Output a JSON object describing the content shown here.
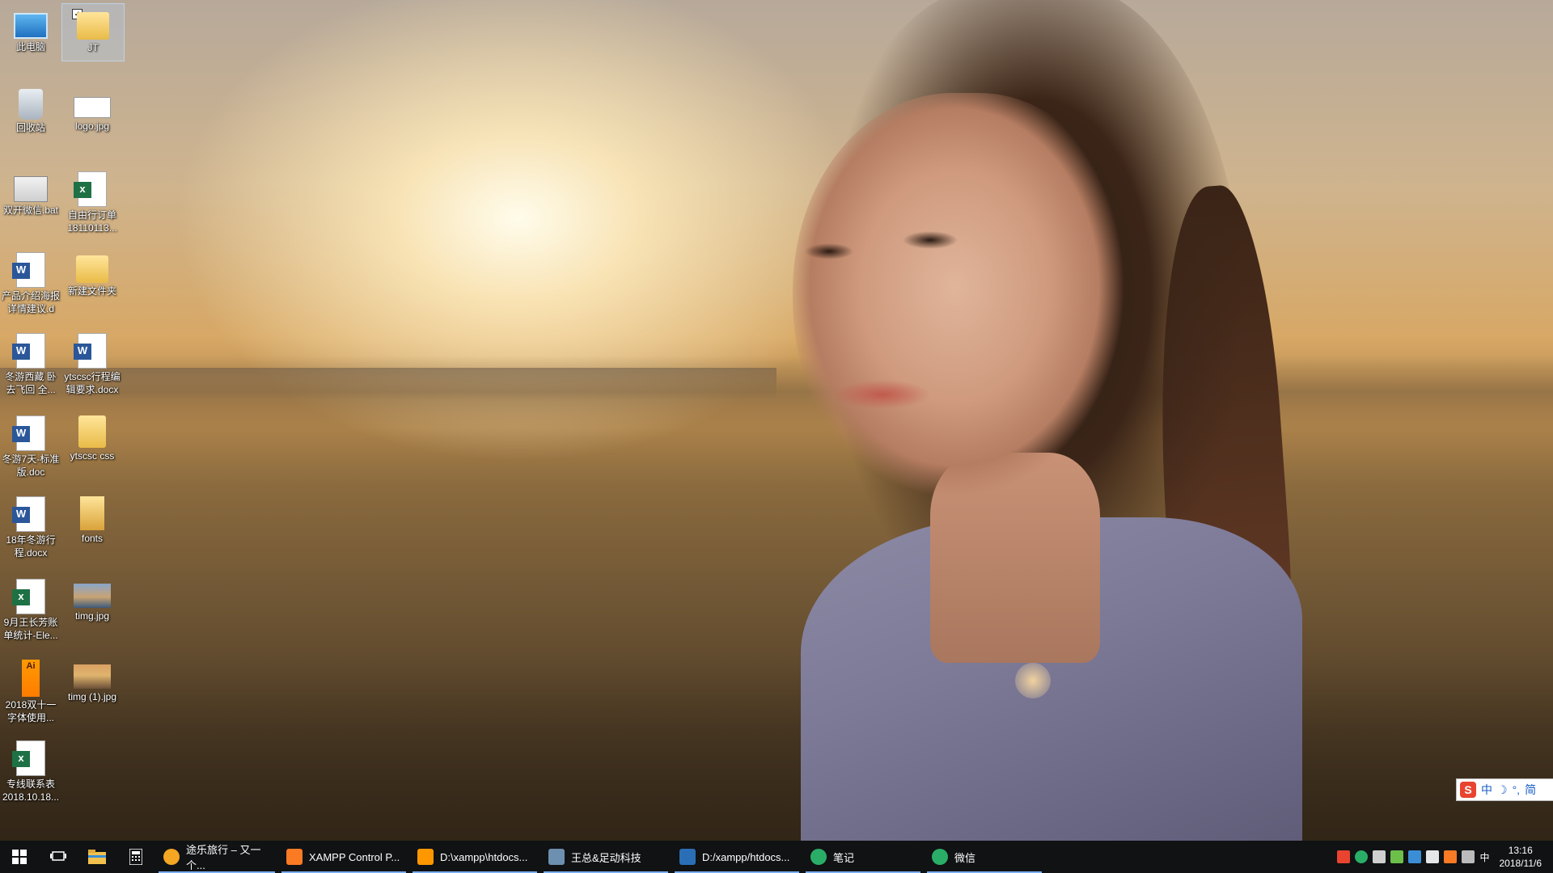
{
  "desktop": {
    "icons": [
      {
        "label": "此电脑",
        "icon": "computer-icon"
      },
      {
        "label": "JT",
        "icon": "folder-icon",
        "selected": true
      },
      {
        "label": "回收站",
        "icon": "recycle-bin-icon"
      },
      {
        "label": "logo.jpg",
        "icon": "image-file-icon"
      },
      {
        "label": "双开微信.bat",
        "icon": "batch-file-icon"
      },
      {
        "label": "自由行订单 18110113...",
        "icon": "excel-file-icon"
      },
      {
        "label": "产品介绍海报 详情建议.d",
        "icon": "word-file-icon"
      },
      {
        "label": "新建文件夹",
        "icon": "folder-icon"
      },
      {
        "label": "冬游西藏 卧 去飞回 全...",
        "icon": "word-file-icon"
      },
      {
        "label": "ytscsc行程编 辑要求.docx",
        "icon": "word-file-icon"
      },
      {
        "label": "冬游7天-标准 版.doc",
        "icon": "word-file-icon"
      },
      {
        "label": "ytscsc css",
        "icon": "folder-icon"
      },
      {
        "label": "18年冬游行 程.docx",
        "icon": "word-file-icon"
      },
      {
        "label": "fonts",
        "icon": "folder-icon"
      },
      {
        "label": "9月王长芳账 单统计-Ele...",
        "icon": "excel-file-icon"
      },
      {
        "label": "timg.jpg",
        "icon": "image-file-icon"
      },
      {
        "label": "2018双十一 字体使用...",
        "icon": "illustrator-file-icon"
      },
      {
        "label": "timg (1).jpg",
        "icon": "image-file-icon"
      },
      {
        "label": "专线联系表 2018.10.18...",
        "icon": "excel-file-icon"
      }
    ]
  },
  "ime": {
    "mode": "中",
    "moon": "☽",
    "punct": "°,",
    "simplified": "简",
    "logo": "S"
  },
  "taskbar": {
    "start_icon": "windows-start-icon",
    "task_view_icon": "task-view-icon",
    "pinned": [
      "file-explorer-icon",
      "calculator-icon"
    ],
    "apps": [
      {
        "label": "途乐旅行 – 又一个...",
        "icon": "browser-icon",
        "color": "#f5a623"
      },
      {
        "label": "XAMPP Control P...",
        "icon": "xampp-icon",
        "color": "#fb7a24"
      },
      {
        "label": "D:\\xampp\\htdocs...",
        "icon": "sublime-icon",
        "color": "#ff9800"
      },
      {
        "label": "王总&足动科技",
        "icon": "chat-avatar-icon",
        "color": "#6d8fb0"
      },
      {
        "label": "D:/xampp/htdocs...",
        "icon": "editor-icon",
        "color": "#2a6fb5"
      },
      {
        "label": "笔记",
        "icon": "wechat-icon",
        "color": "#2aae67"
      },
      {
        "label": "微信",
        "icon": "wechat-icon",
        "color": "#2aae67"
      }
    ],
    "tray": {
      "ime_indicator": "中",
      "time": "13:16",
      "date": "2018/11/6"
    }
  },
  "colors": {
    "taskbar_bg": "#101214",
    "active_underline": "#7aaef0"
  }
}
